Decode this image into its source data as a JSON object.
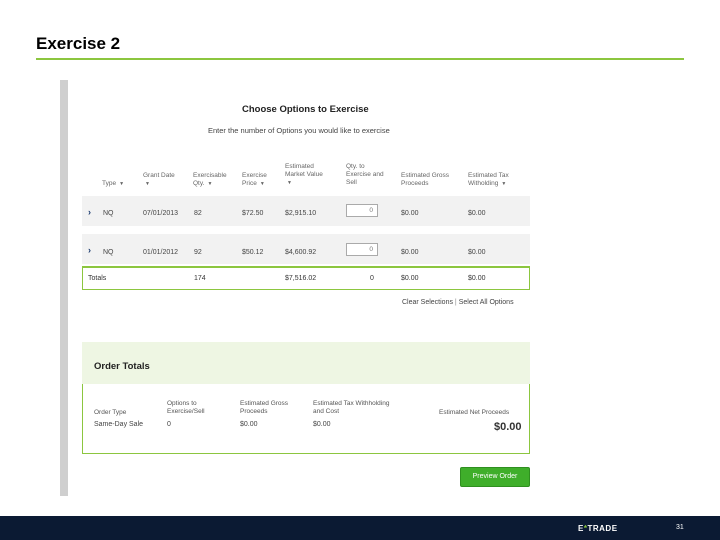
{
  "slide": {
    "title": "Exercise 2",
    "page_number": "31"
  },
  "brand": {
    "logo_prefix": "E",
    "logo_mark": "*",
    "logo_suffix": "TRADE",
    "accent": "#8cc63f",
    "footer_bg": "#0b1a33"
  },
  "panel": {
    "title": "Choose Options to Exercise",
    "instruction": "Enter the number of Options you would like to exercise"
  },
  "columns": {
    "type": "Type",
    "grant_date_1": "Grant Date",
    "exercisable_1": "Exercisable",
    "exercisable_2": "Qty.",
    "price_1": "Exercise",
    "price_2": "Price",
    "mkt_1": "Estimated",
    "mkt_2": "Market Value",
    "qty_1": "Qty. to",
    "qty_2": "Exercise and",
    "qty_3": "Sell",
    "gross_1": "Estimated Gross",
    "gross_2": "Proceeds",
    "tax_1": "Estimated Tax",
    "tax_2": "Witholding"
  },
  "rows": [
    {
      "type": "NQ",
      "grant_date": "07/01/2013",
      "qty": "82",
      "price": "$72.50",
      "market_value": "$2,915.10",
      "input_value": "0",
      "gross": "$0.00",
      "tax": "$0.00"
    },
    {
      "type": "NQ",
      "grant_date": "01/01/2012",
      "qty": "92",
      "price": "$50.12",
      "market_value": "$4,600.92",
      "input_value": "0",
      "gross": "$0.00",
      "tax": "$0.00"
    }
  ],
  "totals": {
    "label": "Totals",
    "qty": "174",
    "market_value": "$7,516.02",
    "exercise": "0",
    "gross": "$0.00",
    "tax": "$0.00"
  },
  "links": {
    "clear": "Clear Selections",
    "separator": "|",
    "select_all": "Select All Options"
  },
  "order": {
    "title": "Order Totals",
    "headers": {
      "type": "Order Type",
      "options_1": "Options to",
      "options_2": "Exercise/Sell",
      "gross_1": "Estimated Gross",
      "gross_2": "Proceeds",
      "tax_1": "Estimated Tax Withholding",
      "tax_2": "and Cost",
      "net": "Estimated Net Proceeds"
    },
    "values": {
      "type": "Same-Day Sale",
      "options": "0",
      "gross": "$0.00",
      "tax": "$0.00",
      "net": "$0.00"
    }
  },
  "buttons": {
    "preview": "Preview Order"
  }
}
